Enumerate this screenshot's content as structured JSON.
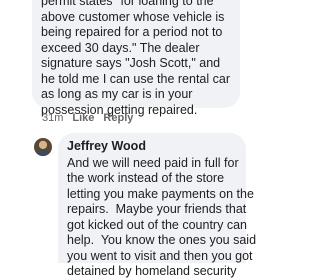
{
  "thread": {
    "reply_1": {
      "text": "permit states \"for loaning to the\nabove customer whose vehicle is\nbeing repaired for a period not to\nexceed 30 days.\" The dealer\nsignature says \"Josh Scott,\" and\nhe told me I can use the rental car\nas long as my car is in your\npossession getting repaired.",
      "timestamp": "31m",
      "like_label": "Like",
      "reply_label": "Reply"
    },
    "reply_2": {
      "author": "Jeffrey Wood",
      "text": "And we will need paid in full for\nthe work instead of the store\nletting you make payments on the\nrepairs.  Maybe your friends that\ngot kicked out of the country can\nhelp.  You know the ones you said\nyou went to visit and then you got\ndetained by homeland security"
    }
  }
}
